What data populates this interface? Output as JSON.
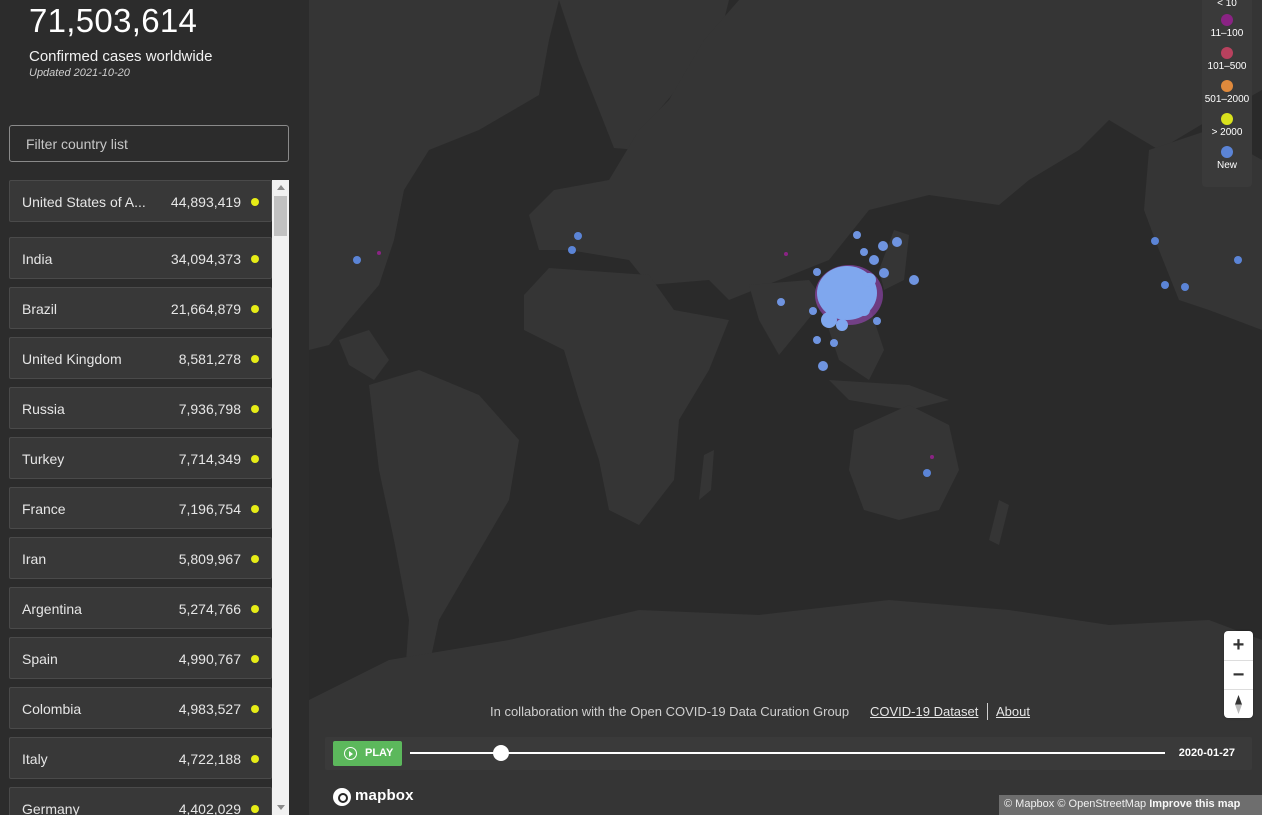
{
  "summary": {
    "total": "71,503,614",
    "label": "Confirmed cases worldwide",
    "updated": "Updated 2021-10-20"
  },
  "filter": {
    "placeholder": "Filter country list"
  },
  "countries": [
    {
      "name": "United States of America",
      "display": "United States of A...",
      "cases": "44,893,419"
    },
    {
      "name": "India",
      "display": "India",
      "cases": "34,094,373"
    },
    {
      "name": "Brazil",
      "display": "Brazil",
      "cases": "21,664,879"
    },
    {
      "name": "United Kingdom",
      "display": "United Kingdom",
      "cases": "8,581,278"
    },
    {
      "name": "Russia",
      "display": "Russia",
      "cases": "7,936,798"
    },
    {
      "name": "Turkey",
      "display": "Turkey",
      "cases": "7,714,349"
    },
    {
      "name": "France",
      "display": "France",
      "cases": "7,196,754"
    },
    {
      "name": "Iran",
      "display": "Iran",
      "cases": "5,809,967"
    },
    {
      "name": "Argentina",
      "display": "Argentina",
      "cases": "5,274,766"
    },
    {
      "name": "Spain",
      "display": "Spain",
      "cases": "4,990,767"
    },
    {
      "name": "Colombia",
      "display": "Colombia",
      "cases": "4,983,527"
    },
    {
      "name": "Italy",
      "display": "Italy",
      "cases": "4,722,188"
    },
    {
      "name": "Germany",
      "display": "Germany",
      "cases": "4,402,029"
    }
  ],
  "colors": {
    "dot_gt_2000": "#e6ec16",
    "legend_11_100": "#8a2384",
    "legend_101_500": "#b8415e",
    "legend_501_2000": "#e08a3c",
    "legend_gt_2000": "#d9e21d",
    "legend_new": "#5b84d6"
  },
  "legend": {
    "items": [
      {
        "label": "< 10",
        "color": ""
      },
      {
        "label": "11–100",
        "color": "#8a2384"
      },
      {
        "label": "101–500",
        "color": "#b8415e"
      },
      {
        "label": "501–2000",
        "color": "#e08a3c"
      },
      {
        "label": "> 2000",
        "color": "#d9e21d"
      },
      {
        "label": "New",
        "color": "#5b84d6"
      }
    ]
  },
  "footer": {
    "collab": "In collaboration with the Open COVID-19 Data Curation Group",
    "dataset_link": "COVID-19 Dataset",
    "about_link": "About"
  },
  "timeline": {
    "play_label": "PLAY",
    "date": "2020-01-27",
    "progress": 0.12
  },
  "map": {
    "logo_text": "mapbox",
    "attribution_mapbox": "© Mapbox",
    "attribution_osm": "© OpenStreetMap",
    "attribution_improve": "Improve this map"
  },
  "zoom": {
    "in_label": "+",
    "out_label": "−"
  }
}
